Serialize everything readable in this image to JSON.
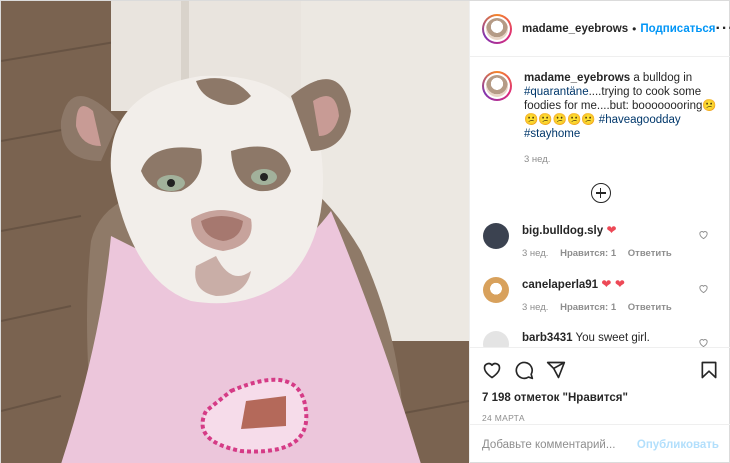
{
  "post": {
    "username": "madame_eyebrows",
    "dot": "•",
    "follow_label": "Подписаться",
    "more_label": "···",
    "caption": {
      "username": "madame_eyebrows",
      "text_1": " a bulldog in ",
      "tag_1": "#quarantäne",
      "text_2": "....trying to cook some foodies for me....but: boooooooring😕😕😕😕😕😕 ",
      "tag_2": "#haveagoodday",
      "text_3": " ",
      "tag_3": "#stayhome",
      "time": "3 нед."
    },
    "comments": [
      {
        "username": "big.bulldog.sly",
        "text": " ❤",
        "time": "3 нед.",
        "likes": "Нравится: 1",
        "reply": "Ответить",
        "avatar_color": "#3b4250"
      },
      {
        "username": "canelaperla91",
        "text": " ❤ ❤",
        "time": "3 нед.",
        "likes": "Нравится: 1",
        "reply": "Ответить",
        "avatar_color": "#d8a15c"
      },
      {
        "username": "barb3431",
        "text": " You sweet girl.",
        "time": "",
        "likes": "",
        "reply": "",
        "avatar_color": "#cfcfcf"
      }
    ],
    "likes_text": "7 198 отметок \"Нравится\"",
    "date": "24 МАРТА",
    "add_comment_placeholder": "Добавьте комментарий...",
    "publish_label": "Опубликовать",
    "icons": [
      "heart-icon",
      "comment-icon",
      "share-icon",
      "bookmark-icon",
      "add-circle-icon"
    ]
  }
}
